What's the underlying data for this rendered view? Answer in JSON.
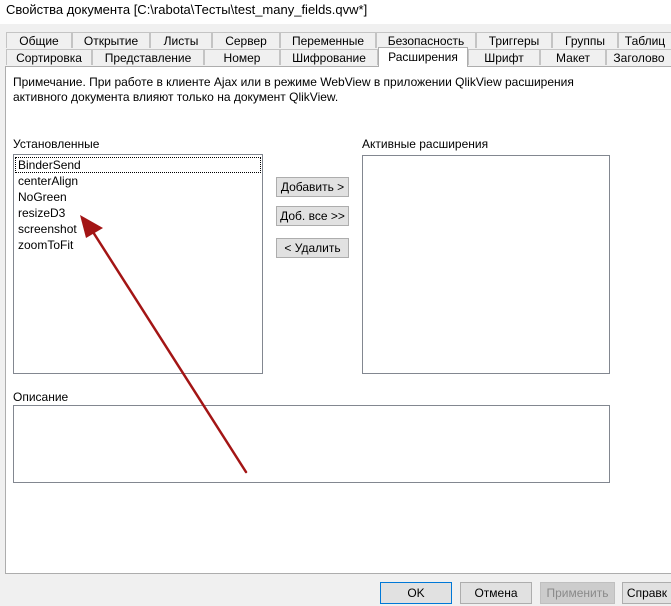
{
  "window": {
    "title": "Свойства документа [C:\\rabota\\Тесты\\test_many_fields.qvw*]"
  },
  "tabs_row1": [
    "Общие",
    "Открытие",
    "Листы",
    "Сервер",
    "Переменные",
    "Безопасность",
    "Триггеры",
    "Группы",
    "Таблиц"
  ],
  "tabs_row2": [
    "Сортировка",
    "Представление",
    "Номер",
    "Шифрование",
    "Расширения",
    "Шрифт",
    "Макет",
    "Заголово"
  ],
  "active_tab": "Расширения",
  "note": "Примечание. При работе в клиенте Ajax или в режиме WebView в приложении QlikView расширения активного документа влияют только на документ QlikView.",
  "installed": {
    "label": "Установленные",
    "items": [
      "BinderSend",
      "centerAlign",
      "NoGreen",
      "resizeD3",
      "screenshot",
      "zoomToFit"
    ]
  },
  "active_extensions": {
    "label": "Активные расширения",
    "items": []
  },
  "buttons": {
    "add": "Добавить >",
    "add_all": "Доб. все >>",
    "remove": "< Удалить"
  },
  "description": {
    "label": "Описание",
    "value": ""
  },
  "footer": {
    "ok": "OK",
    "cancel": "Отмена",
    "apply": "Применить",
    "help": "Справк"
  },
  "colors": {
    "arrow": "#a31515",
    "focus_border": "#0078d7"
  }
}
